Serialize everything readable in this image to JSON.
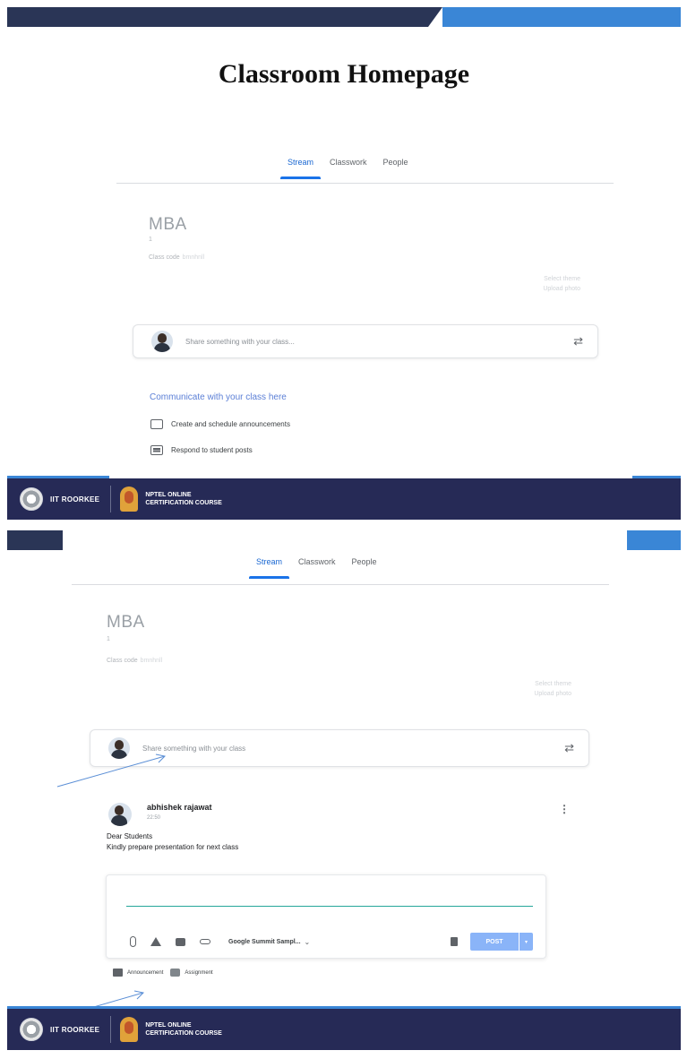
{
  "slide1": {
    "title": "Classroom Homepage",
    "tabs": [
      "Stream",
      "Classwork",
      "People"
    ],
    "class_name": "MBA",
    "class_section": "1",
    "class_code_label": "Class code",
    "class_code_value": "bmnhnll",
    "theme_links": [
      "Select theme",
      "Upload photo"
    ],
    "share_placeholder": "Share something with your class...",
    "communicate_title": "Communicate with your class here",
    "communicate_items": [
      "Create and schedule announcements",
      "Respond to student posts"
    ]
  },
  "slide2": {
    "tabs": [
      "Stream",
      "Classwork",
      "People"
    ],
    "class_name": "MBA",
    "class_section": "1",
    "class_code_label": "Class code",
    "class_code_value": "bmnhnll",
    "theme_links": [
      "Select theme",
      "Upload photo"
    ],
    "share_placeholder": "Share something with your class",
    "post": {
      "author": "abhishek rajawat",
      "time": "22:50",
      "body_line1": "Dear Students",
      "body_line2": "Kindly prepare presentation for next class"
    },
    "composer": {
      "class_selector": "Google Summit Sampl...",
      "post_label": "POST"
    },
    "post_types": [
      "Announcement",
      "Assignment"
    ]
  },
  "footer": {
    "institute": "IIT ROORKEE",
    "nptel_line1": "NPTEL ONLINE",
    "nptel_line2": "CERTIFICATION COURSE"
  },
  "colors": {
    "accent_blue": "#1a73e8",
    "band_blue": "#3a86d6",
    "footer_navy": "#262a56",
    "composer_underline": "#26a69a"
  }
}
